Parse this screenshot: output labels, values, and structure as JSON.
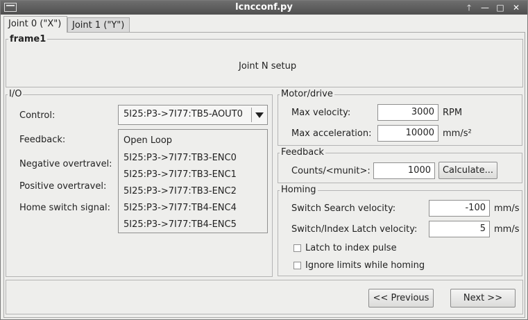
{
  "window": {
    "title": "lcncconf.py"
  },
  "titlebar_buttons": {
    "up": "🡑",
    "minimize": "—",
    "maximize": "□",
    "close": "✕"
  },
  "tabs": [
    {
      "label": "Joint 0 (\"X\")",
      "active": true
    },
    {
      "label": "Joint 1 (\"Y\")",
      "active": false
    }
  ],
  "frame1": {
    "label": "frame1",
    "text": "Joint N setup"
  },
  "io": {
    "label": "I/O",
    "control_label": "Control:",
    "control_value": "5I25:P3->7I77:TB5-AOUT0",
    "feedback_label": "Feedback:",
    "neg_label": "Negative overtravel:",
    "pos_label": "Positive overtravel:",
    "home_label": "Home switch signal:",
    "dropdown_options": [
      "Open Loop",
      "5I25:P3->7I77:TB3-ENC0",
      "5I25:P3->7I77:TB3-ENC1",
      "5I25:P3->7I77:TB3-ENC2",
      "5I25:P3->7I77:TB4-ENC4",
      "5I25:P3->7I77:TB4-ENC5"
    ]
  },
  "motor": {
    "label": "Motor/drive",
    "max_vel_label": "Max velocity:",
    "max_vel_value": "3000",
    "max_vel_unit": "RPM",
    "max_acc_label": "Max acceleration:",
    "max_acc_value": "10000",
    "max_acc_unit": "mm/s²"
  },
  "feedback": {
    "label": "Feedback",
    "counts_label": "Counts/<munit>:",
    "counts_value": "1000",
    "calc_button": "Calculate..."
  },
  "homing": {
    "label": "Homing",
    "search_label": "Switch Search velocity:",
    "search_value": "-100",
    "search_unit": "mm/s",
    "latch_label": "Switch/Index Latch velocity:",
    "latch_value": "5",
    "latch_unit": "mm/s",
    "latch_index_label": "Latch to index pulse",
    "latch_index_checked": false,
    "ignore_limits_label": "Ignore limits while homing",
    "ignore_limits_checked": false
  },
  "nav": {
    "previous": "<< Previous",
    "next": "Next >>"
  }
}
